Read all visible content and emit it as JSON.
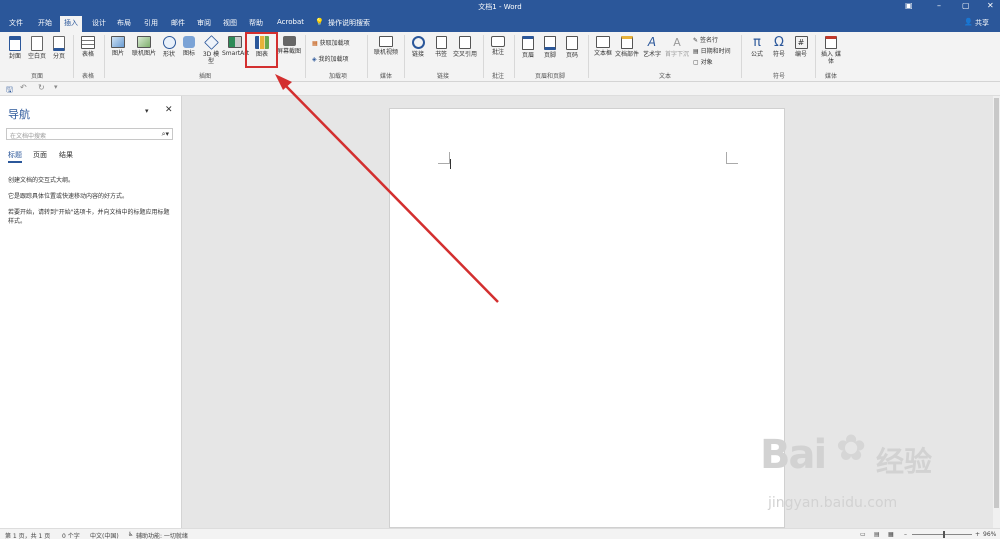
{
  "window": {
    "title": "文档1 - Word",
    "minimize": "–",
    "restore": "▢",
    "close": "✕",
    "ribbon_options": "▣"
  },
  "tabs": [
    "文件",
    "开始",
    "插入",
    "设计",
    "布局",
    "引用",
    "邮件",
    "审阅",
    "视图",
    "帮助",
    "Acrobat"
  ],
  "tell_me": "操作说明搜索",
  "share": "共享",
  "ribbon": {
    "cover": "封面",
    "blank_page": "空白页",
    "page_break": "分页",
    "pages_group": "页面",
    "table": "表格",
    "tables_group": "表格",
    "picture": "图片",
    "online_picture": "联机图片",
    "shapes": "形状",
    "icons": "图标",
    "model_3d": "3D 模型",
    "smartart": "SmartArt",
    "chart": "图表",
    "screenshot": "屏幕截图",
    "illustrations_group": "插图",
    "get_addins": "获取加载项",
    "my_addins": "我的加载项",
    "addins_group": "加载项",
    "online_video": "联机视频",
    "media_group": "媒体",
    "link": "链接",
    "bookmark": "书签",
    "cross_ref": "交叉引用",
    "links_group": "链接",
    "comment": "批注",
    "comments_group": "批注",
    "header": "页眉",
    "footer": "页脚",
    "page_number": "页码",
    "header_footer_group": "页眉和页脚",
    "text_box": "文本框",
    "doc_parts": "文档部件",
    "wordart": "艺术字",
    "drop_cap": "首字下沉",
    "signature": "签名行",
    "datetime": "日期和时间",
    "object": "对象",
    "text_group": "文本",
    "equation": "公式",
    "symbol": "符号",
    "number": "编号",
    "symbols_group": "符号",
    "embed_media": "插入 媒体",
    "media2_group": "媒体"
  },
  "nav": {
    "title": "导航",
    "search_placeholder": "在文档中搜索",
    "tabs": [
      "标题",
      "页面",
      "结果"
    ],
    "p1": "创建文档的交互式大纲。",
    "p2": "它是跟踪具体位置或快速移动内容的好方式。",
    "p3": "若要开始，请转到\"开始\"选项卡，并向文档中的标题应用标题样式。"
  },
  "status": {
    "page": "第 1 页，共 1 页",
    "words": "0 个字",
    "lang": "中文(中国)",
    "accessibility": "辅助功能: 一切就绪",
    "zoom": "96%"
  },
  "watermark": {
    "brand": "Bai",
    "brand2": "经验",
    "url": "jingyan.baidu.com"
  },
  "colors": {
    "title_bar": "#2b579a",
    "annotation": "#d32f2f",
    "ribbon": "#f3f3f3"
  }
}
